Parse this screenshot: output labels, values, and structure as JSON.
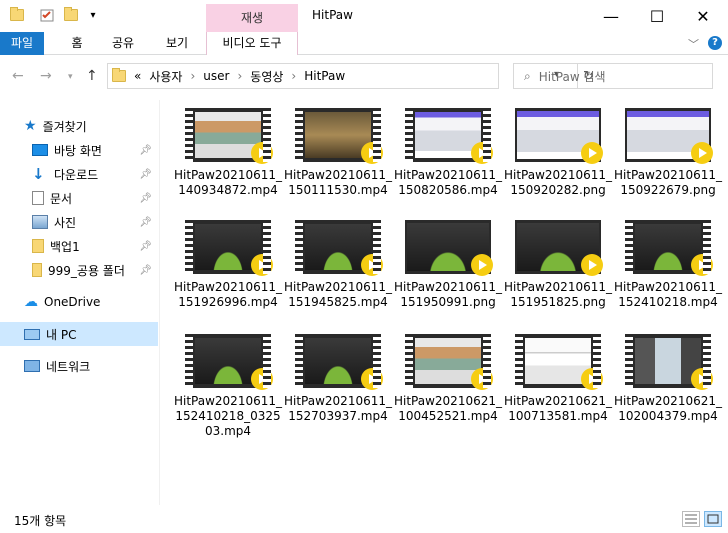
{
  "window": {
    "title": "HitPaw",
    "context_tab": "재생",
    "minimize": "—",
    "maximize": "☐",
    "close": "✕"
  },
  "ribbon": {
    "tabs": [
      "파일",
      "홈",
      "공유",
      "보기"
    ],
    "context_tab": "비디오 도구"
  },
  "address": {
    "overflow": "«",
    "path": [
      "사용자",
      "user",
      "동영상",
      "HitPaw"
    ]
  },
  "search": {
    "placeholder": "HitPaw 검색"
  },
  "sidebar": {
    "quick_access": "즐겨찾기",
    "items": [
      {
        "label": "바탕 화면",
        "icon": "desktop-icon"
      },
      {
        "label": "다운로드",
        "icon": "download-icon"
      },
      {
        "label": "문서",
        "icon": "document-icon"
      },
      {
        "label": "사진",
        "icon": "pictures-icon"
      },
      {
        "label": "백업1",
        "icon": "folder-icon"
      },
      {
        "label": "999_공용 폴더",
        "icon": "folder-icon"
      }
    ],
    "onedrive": "OneDrive",
    "this_pc": "내 PC",
    "network": "네트워크"
  },
  "files": [
    {
      "name": "HitPaw20210611_140934872.mp4",
      "kind": "video",
      "theme": "web"
    },
    {
      "name": "HitPaw20210611_150111530.mp4",
      "kind": "video",
      "theme": "photo"
    },
    {
      "name": "HitPaw20210611_150820586.mp4",
      "kind": "video",
      "theme": "purple"
    },
    {
      "name": "HitPaw20210611_150920282.png",
      "kind": "image",
      "theme": "purple"
    },
    {
      "name": "HitPaw20210611_150922679.png",
      "kind": "image",
      "theme": "purple"
    },
    {
      "name": "HitPaw20210611_151926996.mp4",
      "kind": "video",
      "theme": "dark"
    },
    {
      "name": "HitPaw20210611_151945825.mp4",
      "kind": "video",
      "theme": "dark"
    },
    {
      "name": "HitPaw20210611_151950991.png",
      "kind": "image",
      "theme": "dark"
    },
    {
      "name": "HitPaw20210611_151951825.png",
      "kind": "image",
      "theme": "dark"
    },
    {
      "name": "HitPaw20210611_152410218.mp4",
      "kind": "video",
      "theme": "dark"
    },
    {
      "name": "HitPaw20210611_152410218_032503.mp4",
      "kind": "video",
      "theme": "dark"
    },
    {
      "name": "HitPaw20210611_152703937.mp4",
      "kind": "video",
      "theme": "dark"
    },
    {
      "name": "HitPaw20210621_100452521.mp4",
      "kind": "video",
      "theme": "web"
    },
    {
      "name": "HitPaw20210621_100713581.mp4",
      "kind": "video",
      "theme": "light"
    },
    {
      "name": "HitPaw20210621_102004379.mp4",
      "kind": "video",
      "theme": "room"
    }
  ],
  "status": {
    "count": "15개 항목"
  },
  "colors": {
    "accent": "#1979ca",
    "context_tab": "#f9d1e4",
    "selection": "#cde8ff",
    "play": "#f6cd12"
  }
}
